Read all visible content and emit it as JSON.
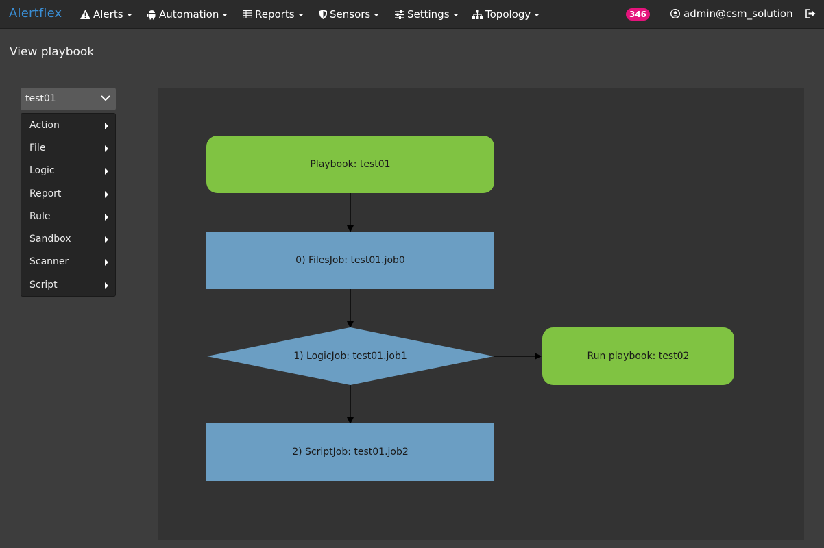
{
  "app": {
    "brand": "Alertflex"
  },
  "nav": {
    "alerts": "Alerts",
    "automation": "Automation",
    "reports": "Reports",
    "sensors": "Sensors",
    "settings": "Settings",
    "topology": "Topology",
    "badge_count": "346",
    "user": "admin@csm_solution"
  },
  "page": {
    "title": "View playbook"
  },
  "playbook_select": {
    "value": "test01"
  },
  "menu": {
    "items": [
      {
        "label": "Action"
      },
      {
        "label": "File"
      },
      {
        "label": "Logic"
      },
      {
        "label": "Report"
      },
      {
        "label": "Rule"
      },
      {
        "label": "Sandbox"
      },
      {
        "label": "Scanner"
      },
      {
        "label": "Script"
      }
    ]
  },
  "diagram": {
    "colors": {
      "start": "#80c342",
      "job": "#6b9ec3",
      "edge": "#000000"
    },
    "nodes": {
      "start": "Playbook: test01",
      "job0": "0) FilesJob: test01.job0",
      "job1": "1) LogicJob: test01.job1",
      "job2": "2) ScriptJob: test01.job2",
      "run": "Run playbook: test02"
    }
  }
}
